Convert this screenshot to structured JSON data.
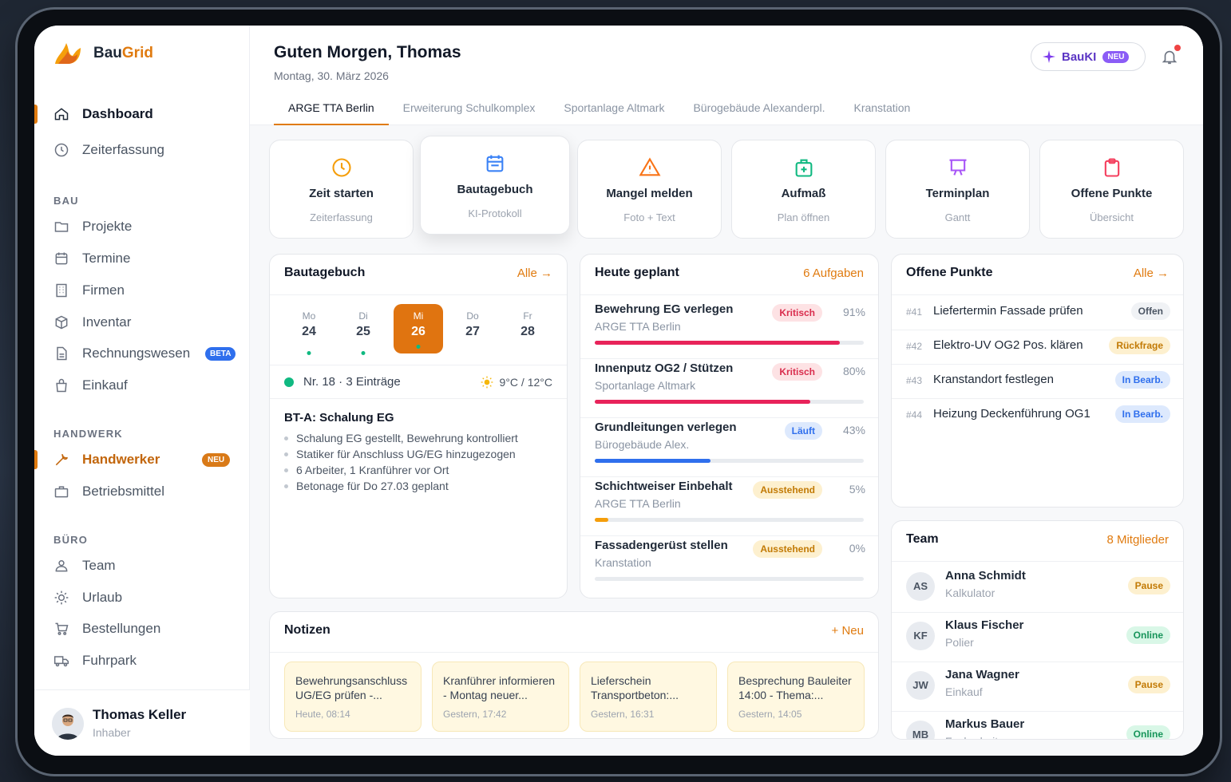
{
  "app": {
    "brand_a": "Bau",
    "brand_b": "Grid"
  },
  "sidebar": {
    "items_top": [
      {
        "label": "Dashboard"
      },
      {
        "label": "Zeiterfassung"
      }
    ],
    "section_bau": "BAU",
    "bau": [
      {
        "label": "Projekte"
      },
      {
        "label": "Termine"
      },
      {
        "label": "Firmen"
      },
      {
        "label": "Inventar"
      },
      {
        "label": "Rechnungswesen",
        "badge": "BETA"
      },
      {
        "label": "Einkauf"
      }
    ],
    "section_handwerk": "HANDWERK",
    "handwerk": [
      {
        "label": "Handwerker",
        "badge": "NEU"
      },
      {
        "label": "Betriebsmittel"
      }
    ],
    "section_buero": "BÜRO",
    "buero": [
      {
        "label": "Team"
      },
      {
        "label": "Urlaub"
      },
      {
        "label": "Bestellungen"
      },
      {
        "label": "Fuhrpark"
      }
    ],
    "user": {
      "name": "Thomas Keller",
      "role": "Inhaber"
    }
  },
  "header": {
    "greeting": "Guten Morgen, Thomas",
    "date": "Montag, 30. März 2026",
    "bauki_label": "BauKI",
    "bauki_badge": "NEU",
    "tabs": [
      "ARGE TTA Berlin",
      "Erweiterung Schulkomplex",
      "Sportanlage Altmark",
      "Bürogebäude Alexanderpl.",
      "Kranstation"
    ]
  },
  "quick_actions": [
    {
      "title": "Zeit starten",
      "sub": "Zeiterfassung",
      "icon": "clock-icon",
      "color": "#f59e0b"
    },
    {
      "title": "Bautagebuch",
      "sub": "KI-Protokoll",
      "icon": "calendar-icon",
      "color": "#3b82f6"
    },
    {
      "title": "Mangel melden",
      "sub": "Foto + Text",
      "icon": "warning-icon",
      "color": "#f97316"
    },
    {
      "title": "Aufmaß",
      "sub": "Plan öffnen",
      "icon": "briefcase-plus-icon",
      "color": "#10b981"
    },
    {
      "title": "Terminplan",
      "sub": "Gantt",
      "icon": "board-icon",
      "color": "#a855f7"
    },
    {
      "title": "Offene Punkte",
      "sub": "Übersicht",
      "icon": "clipboard-icon",
      "color": "#f43f5e"
    }
  ],
  "bautagebuch": {
    "title": "Bautagebuch",
    "link": "Alle →",
    "days": [
      {
        "n": "Mo",
        "d": "24",
        "dot": true
      },
      {
        "n": "Di",
        "d": "25",
        "dot": true
      },
      {
        "n": "Mi",
        "d": "26",
        "dot": true
      },
      {
        "n": "Do",
        "d": "27",
        "dot": false
      },
      {
        "n": "Fr",
        "d": "28",
        "dot": false
      }
    ],
    "status": "Nr. 18 · 3 Einträge",
    "weather": "9°C / 12°C",
    "entry_title": "BT-A: Schalung EG",
    "bullets": [
      "Schalung EG gestellt, Bewehrung kontrolliert",
      "Statiker für Anschluss UG/EG hinzugezogen",
      "6 Arbeiter, 1 Kranführer vor Ort",
      "Betonage für Do 27.03 geplant"
    ]
  },
  "heute": {
    "title": "Heute geplant",
    "count": "6 Aufgaben",
    "tasks": [
      {
        "t": "Bewehrung EG verlegen",
        "s": "ARGE TTA Berlin",
        "badge": "Kritisch",
        "pct": "91%",
        "progress": 0.91,
        "color": "#e8235a"
      },
      {
        "t": "Innenputz OG2 / Stützen",
        "s": "Sportanlage Altmark",
        "badge": "Kritisch",
        "pct": "80%",
        "progress": 0.8,
        "color": "#e8235a"
      },
      {
        "t": "Grundleitungen verlegen",
        "s": "Bürogebäude Alex.",
        "badge": "Läuft",
        "pct": "43%",
        "progress": 0.43,
        "color": "#2f6fed"
      },
      {
        "t": "Schichtweiser Einbehalt",
        "s": "ARGE TTA Berlin",
        "badge": "Ausstehend",
        "pct": "5%",
        "progress": 0.05,
        "color": "#f59e0b"
      },
      {
        "t": "Fassadengerüst stellen",
        "s": "Kranstation",
        "badge": "Ausstehend",
        "pct": "0%",
        "progress": 0,
        "color": "#f59e0b"
      }
    ]
  },
  "offene": {
    "title": "Offene Punkte",
    "link": "Alle →",
    "items": [
      {
        "id": "#41",
        "t": "Liefertermin Fassade prüfen",
        "badge": "Offen"
      },
      {
        "id": "#42",
        "t": "Elektro-UV OG2 Pos. klären",
        "badge": "Rückfrage"
      },
      {
        "id": "#43",
        "t": "Kranstandort festlegen",
        "badge": "In Bearb."
      },
      {
        "id": "#44",
        "t": "Heizung Deckenführung OG1",
        "badge": "In Bearb."
      }
    ]
  },
  "notizen": {
    "title": "Notizen",
    "link": "+ Neu",
    "notes": [
      {
        "t": "Bewehrungsanschluss\nUG/EG prüfen -...",
        "d": "Heute, 08:14"
      },
      {
        "t": "Kranführer informieren\n- Montag neuer...",
        "d": "Gestern, 17:42"
      },
      {
        "t": "Lieferschein\nTransportbeton:...",
        "d": "Gestern, 16:31"
      },
      {
        "t": "Besprechung Bauleiter\n14:00 - Thema:...",
        "d": "Gestern, 14:05"
      }
    ]
  },
  "team": {
    "title": "Team",
    "count": "8 Mitglieder",
    "members": [
      {
        "ini": "AS",
        "n": "Anna Schmidt",
        "r": "Kalkulator",
        "s": "Pause"
      },
      {
        "ini": "KF",
        "n": "Klaus Fischer",
        "r": "Polier",
        "s": "Online"
      },
      {
        "ini": "JW",
        "n": "Jana Wagner",
        "r": "Einkauf",
        "s": "Pause"
      },
      {
        "ini": "MB",
        "n": "Markus Bauer",
        "r": "Facharbeiter",
        "s": "Online"
      }
    ]
  }
}
